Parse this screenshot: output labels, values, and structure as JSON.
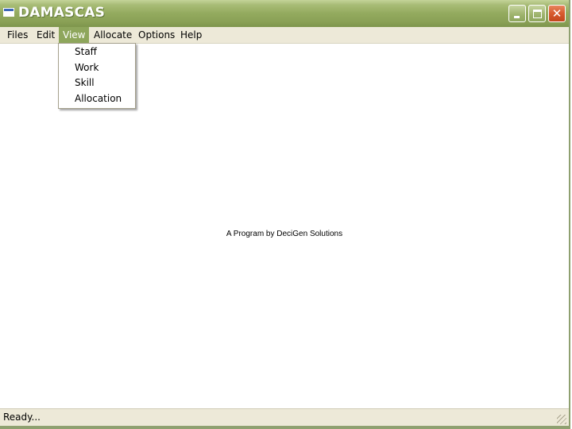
{
  "window": {
    "title": "DAMASCAS"
  },
  "menubar": {
    "items": [
      {
        "label": "Files"
      },
      {
        "label": "Edit"
      },
      {
        "label": "View"
      },
      {
        "label": "Allocate"
      },
      {
        "label": "Options"
      },
      {
        "label": "Help"
      }
    ],
    "active": "View"
  },
  "dropdown": {
    "items": [
      {
        "label": "Staff"
      },
      {
        "label": "Work"
      },
      {
        "label": "Skill"
      },
      {
        "label": "Allocation"
      }
    ]
  },
  "main": {
    "tagline": "A Program by DeciGen Solutions"
  },
  "status": {
    "text": "Ready..."
  },
  "colors": {
    "titlebar": "#93aa5e",
    "menu_highlight": "#8ea65c",
    "close_button": "#d75a2e",
    "chrome": "#ede9d8"
  },
  "icons": {
    "app": "window-icon",
    "minimize": "minimize-icon",
    "maximize": "maximize-icon",
    "close": "close-icon",
    "resize": "resize-grip-icon"
  }
}
